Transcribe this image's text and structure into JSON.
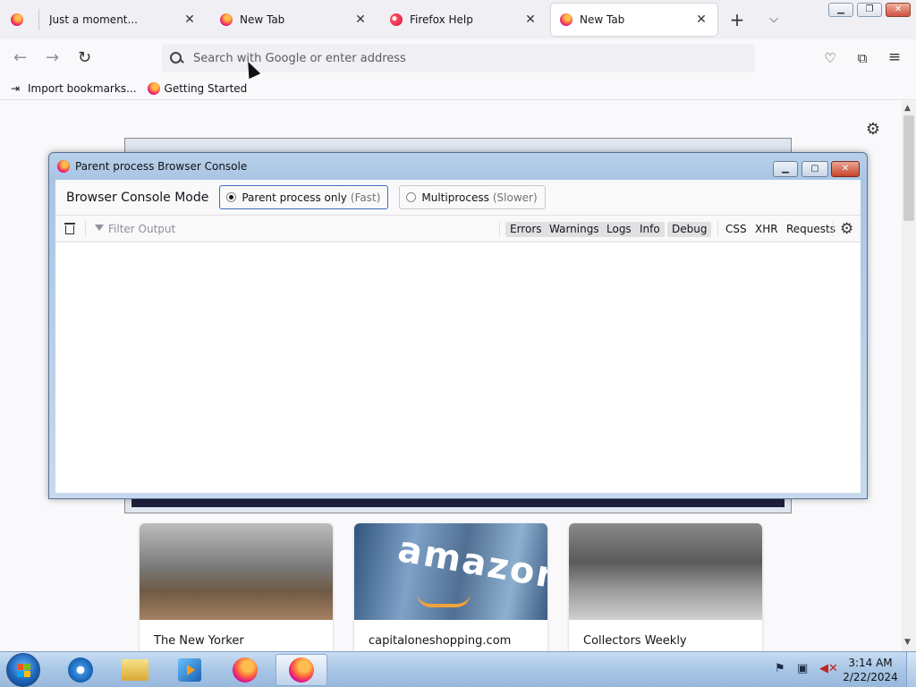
{
  "tabs": [
    {
      "title": "Just a moment...",
      "active": false,
      "icon": "firefox-icon"
    },
    {
      "title": "New Tab",
      "active": false,
      "icon": "firefox-icon"
    },
    {
      "title": "Firefox Help",
      "active": false,
      "icon": "firefox-help-icon"
    },
    {
      "title": "New Tab",
      "active": true,
      "icon": "firefox-icon"
    }
  ],
  "address_bar": {
    "placeholder": "Search with Google or enter address"
  },
  "bookmarks": [
    {
      "label": "Import bookmarks...",
      "icon": "import-icon"
    },
    {
      "label": "Getting Started",
      "icon": "firefox-icon"
    }
  ],
  "tiles": [
    {
      "label": "The New Yorker"
    },
    {
      "label": "capitaloneshopping.com",
      "logo_text": "amazon"
    },
    {
      "label": "Collectors Weekly"
    }
  ],
  "console": {
    "title": "Parent process Browser Console",
    "mode_label": "Browser Console Mode",
    "modes": [
      {
        "label": "Parent process only",
        "sub": "(Fast)",
        "selected": true
      },
      {
        "label": "Multiprocess",
        "sub": "(Slower)",
        "selected": false
      }
    ],
    "filter_placeholder": "Filter Output",
    "levels": [
      "Errors",
      "Warnings",
      "Logs",
      "Info",
      "Debug"
    ],
    "extra_filters": [
      "CSS",
      "XHR",
      "Requests"
    ]
  },
  "taskbar": {
    "apps": [
      "internet-explorer",
      "file-explorer",
      "media-player",
      "firefox",
      "firefox-active"
    ],
    "time": "3:14 AM",
    "date": "2/22/2024"
  },
  "colors": {
    "accent": "#3d6fb8",
    "console_frame": "#a9c5e4",
    "taskbar": "#a8c6e6"
  }
}
